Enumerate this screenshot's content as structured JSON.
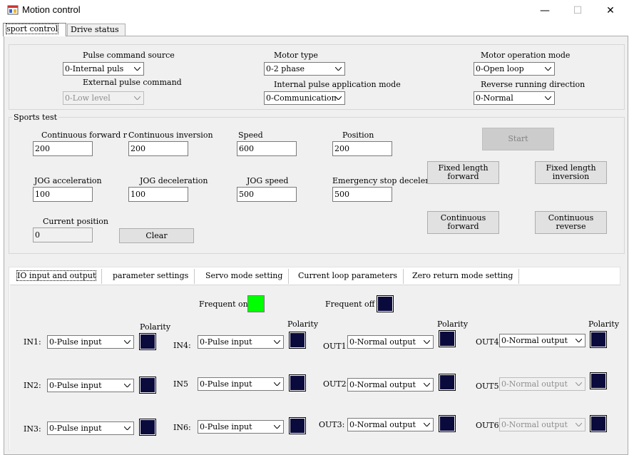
{
  "window": {
    "title": "Motion control",
    "minimize": "—",
    "maximize": "☐",
    "close": "✕"
  },
  "tabs": [
    "sport control",
    "Drive status"
  ],
  "settings": {
    "pulse_command_source": {
      "label": "Pulse command source",
      "value": "0-Internal puls"
    },
    "motor_type": {
      "label": "Motor type",
      "value": "0-2 phase"
    },
    "motor_operation_mode": {
      "label": "Motor operation mode",
      "value": "0-Open loop"
    },
    "external_pulse_command": {
      "label": "External pulse command",
      "value": "0-Low level"
    },
    "internal_pulse_application_mode": {
      "label": "Internal pulse application mode",
      "value": "0-Communication"
    },
    "reverse_running_direction": {
      "label": "Reverse running direction",
      "value": "0-Normal"
    }
  },
  "sports_test": {
    "title": "Sports test",
    "continuous_forward": {
      "label": "Continuous forward r",
      "value": "200"
    },
    "continuous_inversion": {
      "label": "Continuous inversion",
      "value": "200"
    },
    "speed": {
      "label": "Speed",
      "value": "600"
    },
    "position": {
      "label": "Position",
      "value": "200"
    },
    "jog_acceleration": {
      "label": "JOG acceleration",
      "value": "100"
    },
    "jog_deceleration": {
      "label": "JOG deceleration",
      "value": "100"
    },
    "jog_speed": {
      "label": "JOG speed",
      "value": "500"
    },
    "emergency_stop_deceleration": {
      "label": "Emergency stop deceleration",
      "value": "500"
    },
    "current_position": {
      "label": "Current position",
      "value": "0"
    },
    "clear_label": "Clear",
    "start_label": "Start",
    "fixed_length_forward": [
      "Fixed length",
      "forward"
    ],
    "fixed_length_inversion": [
      "Fixed length",
      "inversion"
    ],
    "continuous_forward_btn": [
      "Continuous",
      "forward"
    ],
    "continuous_reverse_btn": [
      "Continuous",
      "reverse"
    ]
  },
  "inner_tabs": [
    "IO input and output",
    "parameter settings",
    "Servo mode setting",
    "Current loop parameters",
    "Zero return mode setting"
  ],
  "io": {
    "frequent_on": "Frequent on",
    "frequent_off": "Frequent off",
    "polarity": "Polarity",
    "colors": {
      "on": "#00ff00",
      "off": "#0a0a3c"
    },
    "inputs": [
      {
        "name": "IN1:",
        "value": "0-Pulse input"
      },
      {
        "name": "IN2:",
        "value": "0-Pulse input"
      },
      {
        "name": "IN3:",
        "value": "0-Pulse input"
      },
      {
        "name": "IN4:",
        "value": "0-Pulse input"
      },
      {
        "name": "IN5",
        "value": "0-Pulse input"
      },
      {
        "name": "IN6:",
        "value": "0-Pulse input"
      }
    ],
    "outputs": [
      {
        "name": "OUT1:",
        "value": "0-Normal output"
      },
      {
        "name": "OUT2:",
        "value": "0-Normal output"
      },
      {
        "name": "OUT3:",
        "value": "0-Normal output"
      },
      {
        "name": "OUT4:",
        "value": "0-Normal output"
      },
      {
        "name": "OUT5:",
        "value": "0-Normal output"
      },
      {
        "name": "OUT6:",
        "value": "0-Normal output"
      }
    ]
  }
}
